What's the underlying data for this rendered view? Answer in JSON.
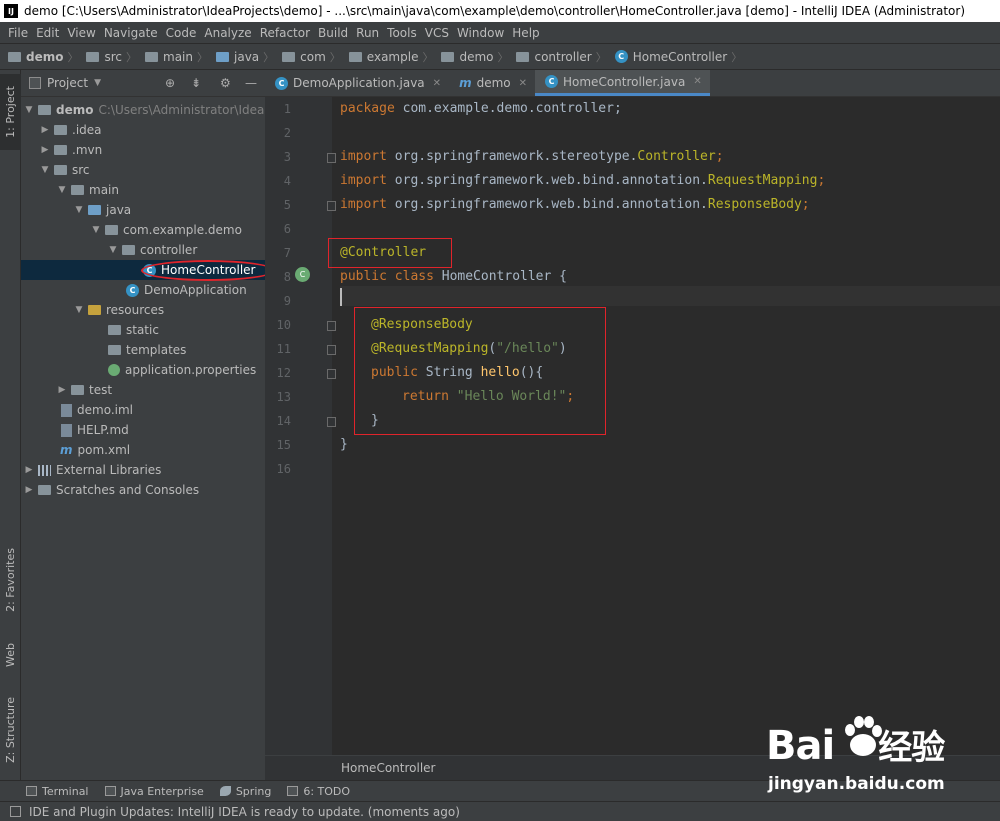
{
  "window": {
    "title": "demo [C:\\Users\\Administrator\\IdeaProjects\\demo] - ...\\src\\main\\java\\com\\example\\demo\\controller\\HomeController.java [demo] - IntelliJ IDEA (Administrator)"
  },
  "menu": [
    "File",
    "Edit",
    "View",
    "Navigate",
    "Code",
    "Analyze",
    "Refactor",
    "Build",
    "Run",
    "Tools",
    "VCS",
    "Window",
    "Help"
  ],
  "breadcrumb": [
    "demo",
    "src",
    "main",
    "java",
    "com",
    "example",
    "demo",
    "controller",
    "HomeController"
  ],
  "left_tabs": {
    "project": "1: Project",
    "favorites": "2: Favorites",
    "web": "Web",
    "structure": "Z: Structure"
  },
  "project_panel": {
    "title": "Project",
    "tree": [
      {
        "label": "demo",
        "sub": "C:\\Users\\Administrator\\IdeaPr"
      },
      {
        "label": ".idea"
      },
      {
        "label": ".mvn"
      },
      {
        "label": "src"
      },
      {
        "label": "main"
      },
      {
        "label": "java"
      },
      {
        "label": "com.example.demo"
      },
      {
        "label": "controller"
      },
      {
        "label": "HomeController"
      },
      {
        "label": "DemoApplication"
      },
      {
        "label": "resources"
      },
      {
        "label": "static"
      },
      {
        "label": "templates"
      },
      {
        "label": "application.properties"
      },
      {
        "label": "test"
      },
      {
        "label": "demo.iml"
      },
      {
        "label": "HELP.md"
      },
      {
        "label": "pom.xml"
      },
      {
        "label": "External Libraries"
      },
      {
        "label": "Scratches and Consoles"
      }
    ]
  },
  "tabs": [
    "DemoApplication.java",
    "demo",
    "HomeController.java"
  ],
  "editor": {
    "line_numbers": [
      "1",
      "2",
      "3",
      "4",
      "5",
      "6",
      "7",
      "8",
      "9",
      "10",
      "11",
      "12",
      "13",
      "14",
      "15",
      "16"
    ],
    "code": {
      "l1_kw": "package",
      "l1_rest": " com.example.demo.controller;",
      "l3_kw": "import",
      "l3_rest": " org.springframework.stereotype.",
      "l3_cls": "Controller",
      "l3_end": ";",
      "l4_kw": "import",
      "l4_rest": " org.springframework.web.bind.annotation.",
      "l4_cls": "RequestMapping",
      "l4_end": ";",
      "l5_kw": "import",
      "l5_rest": " org.springframework.web.bind.annotation.",
      "l5_cls": "ResponseBody",
      "l5_end": ";",
      "l7_ann": "@Controller",
      "l8_kw": "public class",
      "l8_rest": " HomeController {",
      "l10_ann": "@ResponseBody",
      "l11_ann": "@RequestMapping",
      "l11_open": "(",
      "l11_str": "\"/hello\"",
      "l11_close": ")",
      "l12_kw": "public",
      "l12_type": " String ",
      "l12_fn": "hello",
      "l12_rest": "(){",
      "l13_kw": "return",
      "l13_str": " \"Hello World!\"",
      "l13_end": ";",
      "l14": "}",
      "l15": "}"
    },
    "bottom_crumb": "HomeController"
  },
  "bottom_tools": [
    "Terminal",
    "Java Enterprise",
    "Spring",
    "6: TODO"
  ],
  "status": "IDE and Plugin Updates: IntelliJ IDEA is ready to update. (moments ago)",
  "watermark": {
    "brand": "Bai",
    "brand_cn": "经验",
    "url": "jingyan.baidu.com"
  }
}
